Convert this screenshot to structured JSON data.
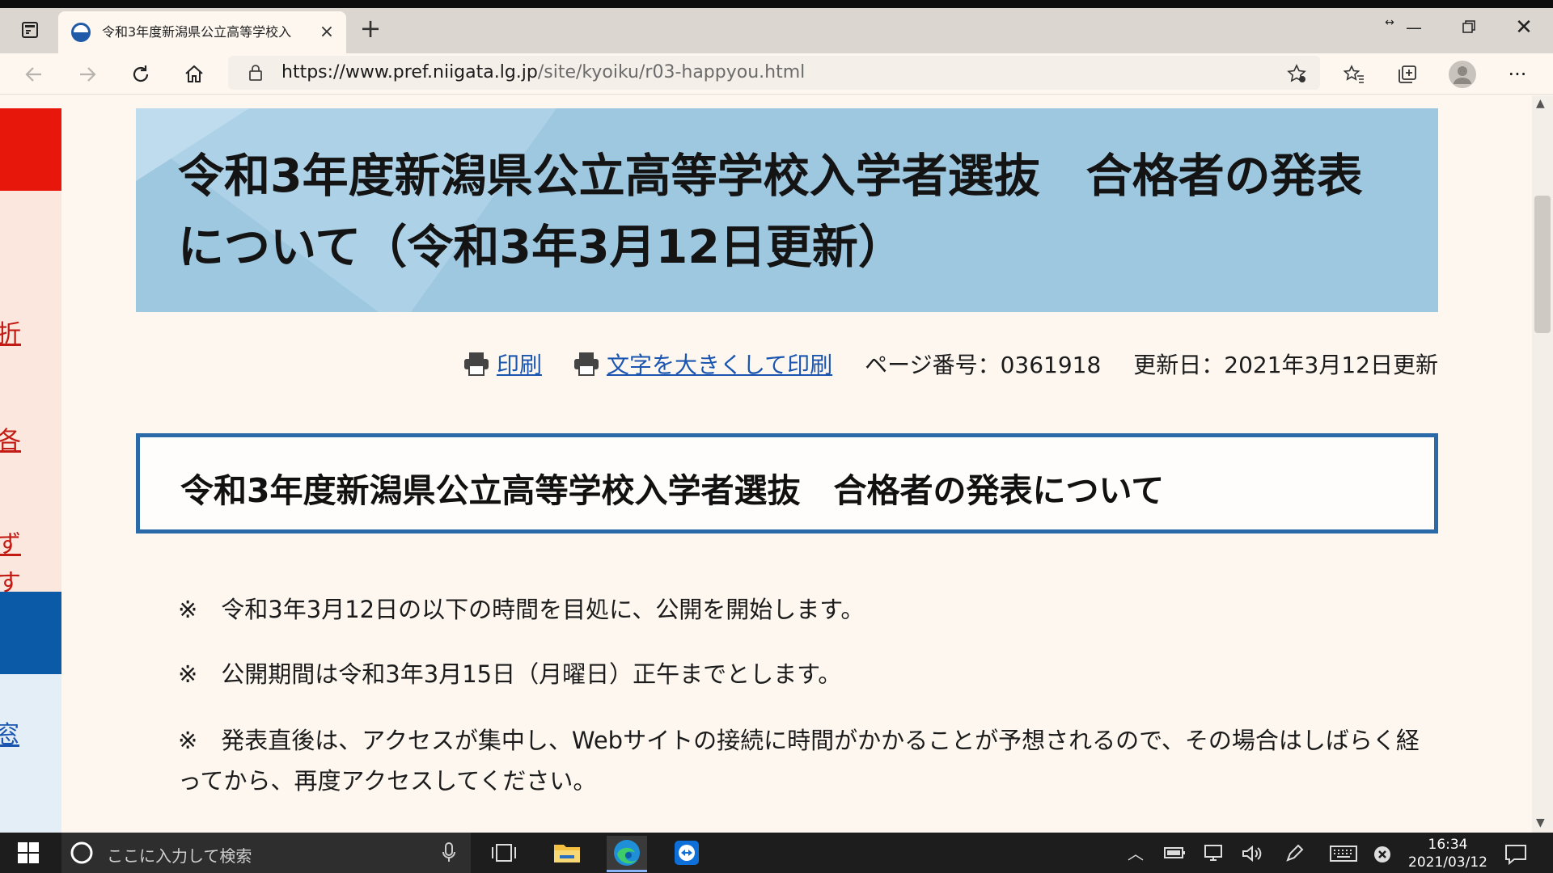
{
  "browser": {
    "tab_title": "令和3年度新潟県公立高等学校入",
    "url_host": "https://www.pref.niigata.lg.jp",
    "url_path": "/site/kyoiku/r03-happyou.html"
  },
  "sidebar": {
    "fragments": [
      "折",
      "各",
      "ず",
      "す",
      "窓"
    ]
  },
  "page": {
    "title": "令和3年度新潟県公立高等学校入学者選抜　合格者の発表について（令和3年3月12日更新）",
    "print_label": "印刷",
    "large_print_label": "文字を大きくして印刷",
    "page_number": "ページ番号：0361918",
    "updated": "更新日：2021年3月12日更新",
    "section_heading": "令和3年度新潟県公立高等学校入学者選抜　合格者の発表について",
    "notes": [
      "※　令和3年3月12日の以下の時間を目処に、公開を開始します。",
      "※　公開期間は令和3年3月15日（月曜日）正午までとします。",
      "※　発表直後は、アクセスが集中し、Webサイトの接続に時間がかかることが予想されるので、その場合はしばらく経ってから、再度アクセスしてください。"
    ]
  },
  "taskbar": {
    "search_placeholder": "ここに入力して検索",
    "time": "16:34",
    "date": "2021/03/12"
  },
  "colors": {
    "banner": "#9ec8e0",
    "link": "#1a56b0",
    "heading_border": "#2b6aa8",
    "sidebar_red": "#e8170b",
    "sidebar_blue": "#0a5aa8"
  }
}
